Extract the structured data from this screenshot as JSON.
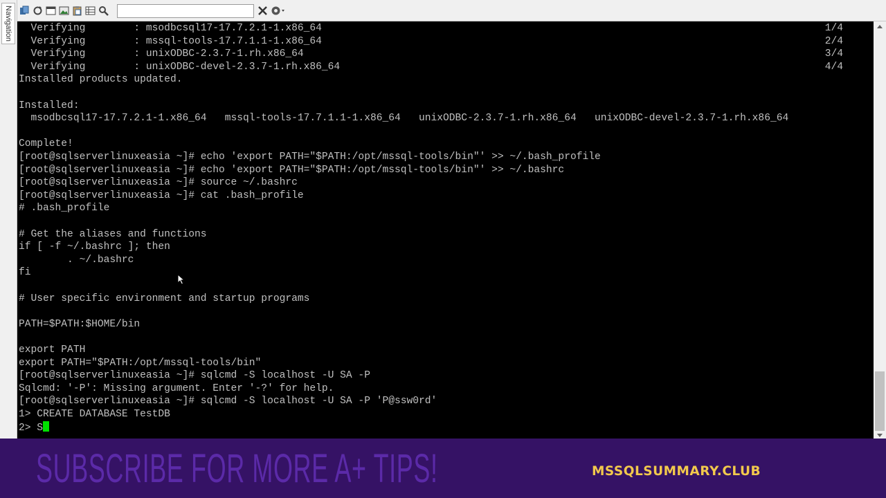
{
  "navigation": {
    "label": "Navigation"
  },
  "toolbar": {
    "icons": [
      "copy-icon",
      "refresh-icon",
      "open-window-icon",
      "image-icon",
      "paste-icon",
      "grid-icon",
      "search-icon"
    ],
    "search": {
      "value": "",
      "placeholder": ""
    }
  },
  "terminal": {
    "lines": [
      "  Verifying        : msodbcsql17-17.7.2.1-1.x86_64                                                                                   1/4",
      "  Verifying        : mssql-tools-17.7.1.1-1.x86_64                                                                                   2/4",
      "  Verifying        : unixODBC-2.3.7-1.rh.x86_64                                                                                      3/4",
      "  Verifying        : unixODBC-devel-2.3.7-1.rh.x86_64                                                                                4/4",
      "Installed products updated.",
      "",
      "Installed:",
      "  msodbcsql17-17.7.2.1-1.x86_64   mssql-tools-17.7.1.1-1.x86_64   unixODBC-2.3.7-1.rh.x86_64   unixODBC-devel-2.3.7-1.rh.x86_64",
      "",
      "Complete!",
      "[root@sqlserverlinuxeasia ~]# echo 'export PATH=\"$PATH:/opt/mssql-tools/bin\"' >> ~/.bash_profile",
      "[root@sqlserverlinuxeasia ~]# echo 'export PATH=\"$PATH:/opt/mssql-tools/bin\"' >> ~/.bashrc",
      "[root@sqlserverlinuxeasia ~]# source ~/.bashrc",
      "[root@sqlserverlinuxeasia ~]# cat .bash_profile",
      "# .bash_profile",
      "",
      "# Get the aliases and functions",
      "if [ -f ~/.bashrc ]; then",
      "        . ~/.bashrc",
      "fi",
      "",
      "# User specific environment and startup programs",
      "",
      "PATH=$PATH:$HOME/bin",
      "",
      "export PATH",
      "export PATH=\"$PATH:/opt/mssql-tools/bin\"",
      "[root@sqlserverlinuxeasia ~]# sqlcmd -S localhost -U SA -P",
      "Sqlcmd: '-P': Missing argument. Enter '-?' for help.",
      "[root@sqlserverlinuxeasia ~]# sqlcmd -S localhost -U SA -P 'P@ssw0rd'",
      "1> CREATE DATABASE TestDB",
      "2> S"
    ]
  },
  "banner": {
    "left_text": "SUBSCRIBE FOR MORE A+ TIPS!",
    "right_text": "MSSQLSUMMARY.CLUB"
  }
}
